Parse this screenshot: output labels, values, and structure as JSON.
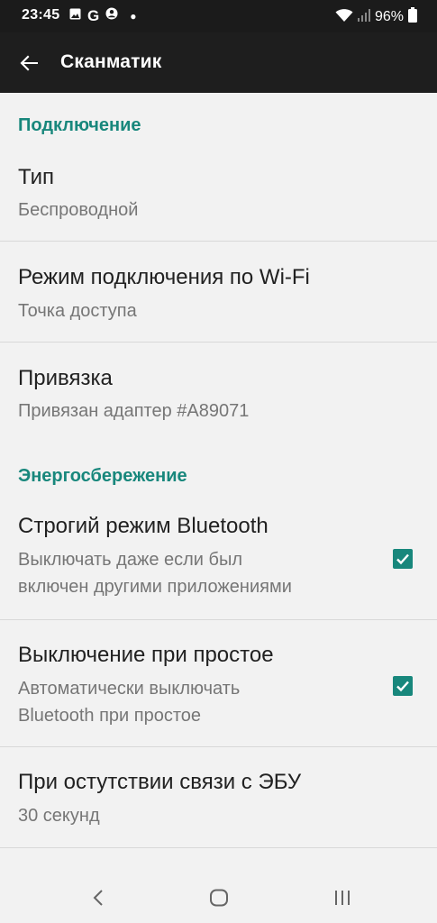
{
  "status_bar": {
    "time": "23:45",
    "battery": "96%"
  },
  "app_bar": {
    "title": "Сканматик"
  },
  "sections": {
    "connection": {
      "header": "Подключение",
      "items": [
        {
          "title": "Тип",
          "summary": "Беспроводной"
        },
        {
          "title": "Режим подключения по Wi-Fi",
          "summary": "Точка доступа"
        },
        {
          "title": "Привязка",
          "summary": "Привязан адаптер #A89071"
        }
      ]
    },
    "power": {
      "header": "Энергосбережение",
      "items": [
        {
          "title": "Строгий режим Bluetooth",
          "summary_line1": "Выключать даже если был",
          "summary_line2": "включен другими приложениями",
          "checked": true
        },
        {
          "title": "Выключение при простое",
          "summary_line1": "Автоматически выключать",
          "summary_line2": "Bluetooth при простое",
          "checked": true
        },
        {
          "title": "При остутствии связи с ЭБУ",
          "summary": "30 секунд"
        }
      ]
    }
  },
  "colors": {
    "accent": "#18877c",
    "app_bar": "#1e1e1e",
    "status_bar": "#1b1b1b",
    "background": "#f2f2f2"
  }
}
